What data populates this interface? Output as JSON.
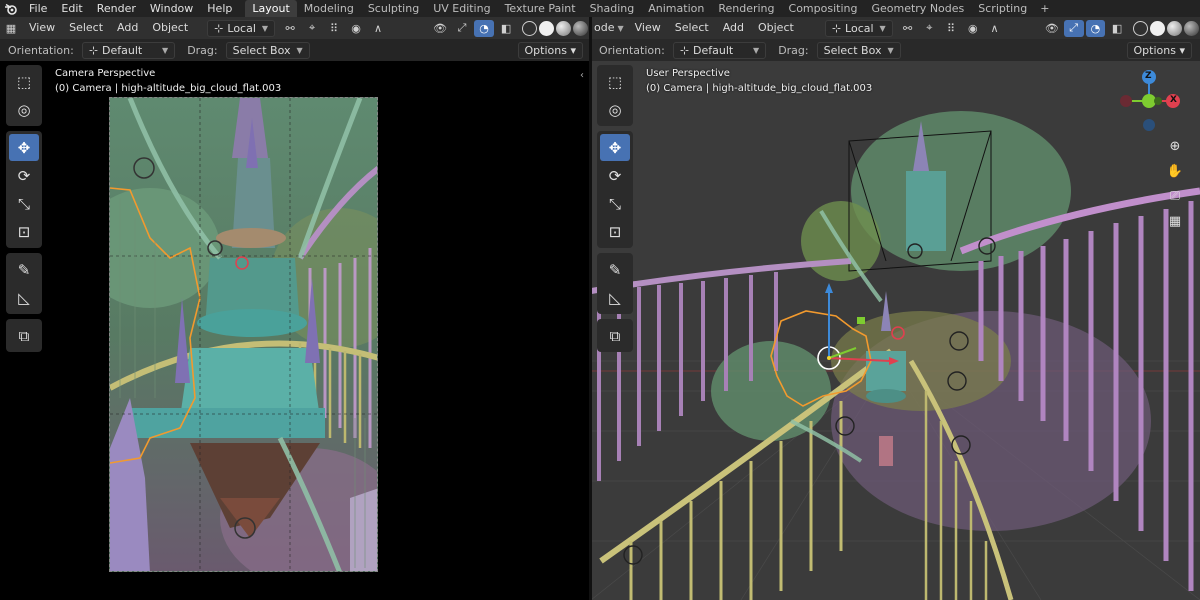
{
  "app": {
    "menu": [
      "File",
      "Edit",
      "Render",
      "Window",
      "Help"
    ],
    "workspace_tabs": [
      "Layout",
      "Modeling",
      "Sculpting",
      "UV Editing",
      "Texture Paint",
      "Shading",
      "Animation",
      "Rendering",
      "Compositing",
      "Geometry Nodes",
      "Scripting"
    ],
    "active_tab": "Layout",
    "add_tab_icon": "plus-icon"
  },
  "left_view": {
    "header_menus": [
      "View",
      "Select",
      "Add",
      "Object"
    ],
    "transform_orientation": "Local",
    "orientation_label": "Orientation:",
    "orientation_value": "Default",
    "drag_label": "Drag:",
    "drag_value": "Select Box",
    "options_label": "Options",
    "perspective_title": "Camera Perspective",
    "object_info": "(0) Camera | high-altitude_big_cloud_flat.003"
  },
  "right_view": {
    "mode_fragment": "ode",
    "header_menus": [
      "View",
      "Select",
      "Add",
      "Object"
    ],
    "transform_orientation": "Local",
    "orientation_label": "Orientation:",
    "orientation_value": "Default",
    "drag_label": "Drag:",
    "drag_value": "Select Box",
    "options_label": "Options",
    "perspective_title": "User Perspective",
    "object_info": "(0) Camera | high-altitude_big_cloud_flat.003",
    "gizmo_axes": [
      "Z",
      "X"
    ]
  },
  "toolbar_tools": [
    "select-box-icon",
    "cursor-icon",
    "move-icon",
    "rotate-icon",
    "scale-icon",
    "transform-icon",
    "annotate-icon",
    "measure-icon",
    "add-cube-icon"
  ],
  "colors": {
    "accent_blue": "#4772b3",
    "axis_x": "#e0404f",
    "axis_y": "#7ecc30",
    "axis_z": "#3d8ad9",
    "selection_orange": "#f29a2e",
    "railing_purple": "#a77fb5",
    "railing_yellow": "#b7b26a",
    "teal_tower": "#4d9a8e"
  }
}
